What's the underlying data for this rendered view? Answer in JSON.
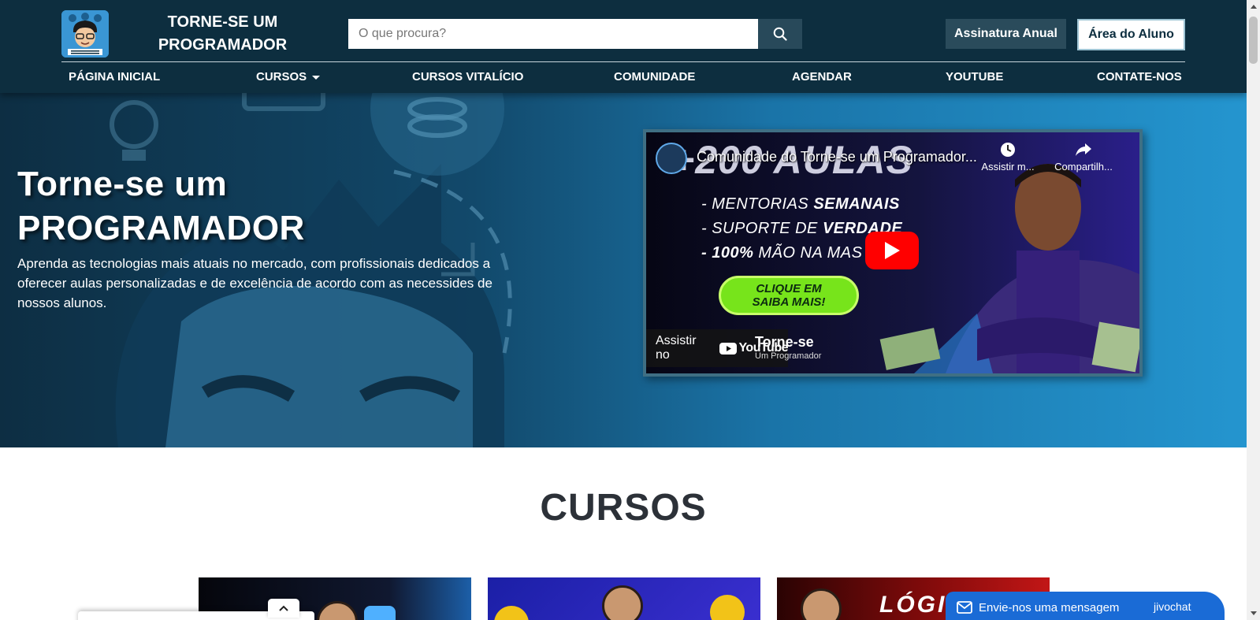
{
  "header": {
    "brand_line1": "TORNE-SE UM",
    "brand_line2": "PROGRAMADOR",
    "search_placeholder": "O que procura?",
    "search_icon": "search-icon",
    "btn_anual": "Assinatura Anual",
    "btn_aluno": "Área do Aluno"
  },
  "nav": {
    "items": [
      {
        "label": "PÁGINA INICIAL"
      },
      {
        "label": "CURSOS"
      },
      {
        "label": "CURSOS VITALÍCIO"
      },
      {
        "label": "COMUNIDADE"
      },
      {
        "label": "AGENDAR"
      },
      {
        "label": "YOUTUBE"
      },
      {
        "label": "CONTATE-NOS"
      }
    ]
  },
  "hero": {
    "title_line1": "Torne-se um",
    "title_line2": "PROGRAMADOR",
    "description": "Aprenda as tecnologias mais atuais no mercado, com profissionais dedicados a oferecer aulas personalizadas e de excelência de acordo com as necessides de nossos alunos."
  },
  "video": {
    "title": "Comunidade do Torne-se um Programador...",
    "big_text": "+200 AULAS",
    "watch_later": "Assistir m...",
    "share": "Compartilh...",
    "line1_a": "- MENTORIAS ",
    "line1_b": "SEMANAIS",
    "line2_a": "- SUPORTE DE ",
    "line2_b": "VERDADE",
    "line3_a": "- 100%",
    "line3_b": " MÃO NA MAS",
    "cta_line1": "CLIQUE EM",
    "cta_line2": "SAIBA MAIS!",
    "watch_on": "Assistir no",
    "youtube": "YouTube",
    "brand_overlay": "Torne-se",
    "brand_overlay_sub": "Um Programador"
  },
  "cursos": {
    "title": "CURSOS",
    "card3_title": "LÓGI"
  },
  "chat": {
    "label": "Envie-nos uma mensagem",
    "brand": "jivochat"
  },
  "colors": {
    "header_bg": "#0d2e3f",
    "hero_left": "#0d2e43",
    "hero_right": "#2495cf",
    "chat_bg": "#1a6bd6",
    "youtube_red": "#ff0000"
  }
}
